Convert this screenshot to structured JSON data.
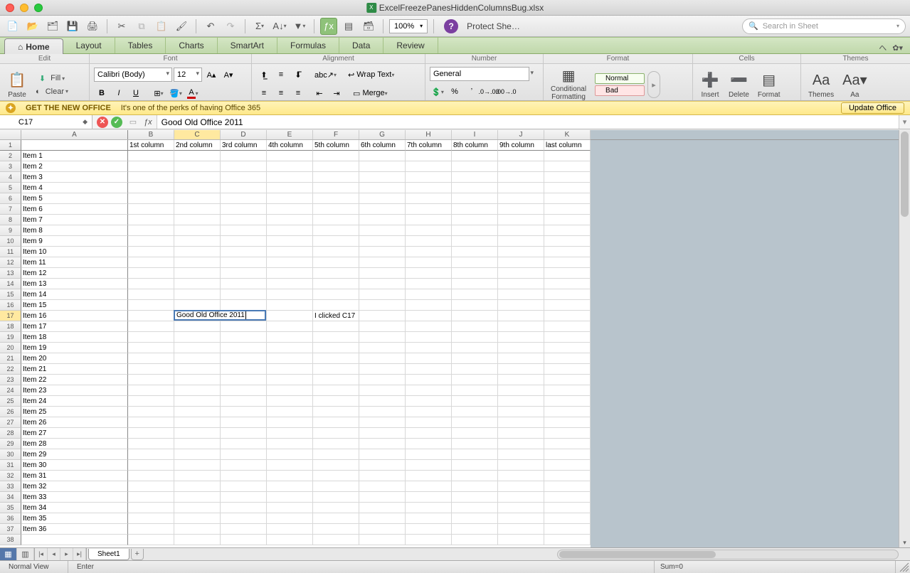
{
  "title": "ExcelFreezePanesHiddenColumnsBug.xlsx",
  "qat": {
    "zoom": "100%",
    "protect": "Protect She…",
    "search_placeholder": "Search in Sheet"
  },
  "tabs": [
    "Home",
    "Layout",
    "Tables",
    "Charts",
    "SmartArt",
    "Formulas",
    "Data",
    "Review"
  ],
  "activeTab": "Home",
  "groups": {
    "edit": "Edit",
    "font": "Font",
    "alignment": "Alignment",
    "number": "Number",
    "format": "Format",
    "cells": "Cells",
    "themes": "Themes",
    "paste": "Paste",
    "fill": "Fill",
    "clear": "Clear",
    "wrap": "Wrap Text",
    "merge": "Merge",
    "general": "General",
    "conditional": "Conditional\nFormatting",
    "normal": "Normal",
    "bad": "Bad",
    "insert": "Insert",
    "delete": "Delete",
    "formatC": "Format",
    "themesB": "Themes",
    "aa": "Aa"
  },
  "font": {
    "name": "Calibri (Body)",
    "size": "12"
  },
  "banner": {
    "title": "GET THE NEW OFFICE",
    "msg": "It's one of the perks of having Office 365",
    "btn": "Update Office"
  },
  "formula": {
    "ref": "C17",
    "value": "Good Old Office 2011"
  },
  "columns": [
    "A",
    "B",
    "C",
    "D",
    "E",
    "F",
    "G",
    "H",
    "I",
    "J",
    "K"
  ],
  "headerRow": [
    "",
    "1st column",
    "2nd column",
    "3rd column",
    "4th column",
    "5th column",
    "6th column",
    "7th column",
    "8th column",
    "9th column",
    "last column"
  ],
  "rowLabels": [
    "Item 1",
    "Item 2",
    "Item 3",
    "Item 4",
    "Item 5",
    "Item 6",
    "Item 7",
    "Item 8",
    "Item 9",
    "Item 10",
    "Item 11",
    "Item 12",
    "Item 13",
    "Item 14",
    "Item 15",
    "Item 16",
    "Item 17",
    "Item 18",
    "Item 19",
    "Item 20",
    "Item 21",
    "Item 22",
    "Item 23",
    "Item 24",
    "Item 25",
    "Item 26",
    "Item 27",
    "Item 28",
    "Item 29",
    "Item 30",
    "Item 31",
    "Item 32",
    "Item 33",
    "Item 34",
    "Item 35",
    "Item 36"
  ],
  "activeCell": {
    "row": 17,
    "col": "C",
    "overflowCols": 2,
    "text": "Good Old Office 2011"
  },
  "extra": {
    "F17": "I clicked C17"
  },
  "sheet": {
    "name": "Sheet1"
  },
  "status": {
    "view": "Normal View",
    "mode": "Enter",
    "sum": "Sum=0"
  }
}
